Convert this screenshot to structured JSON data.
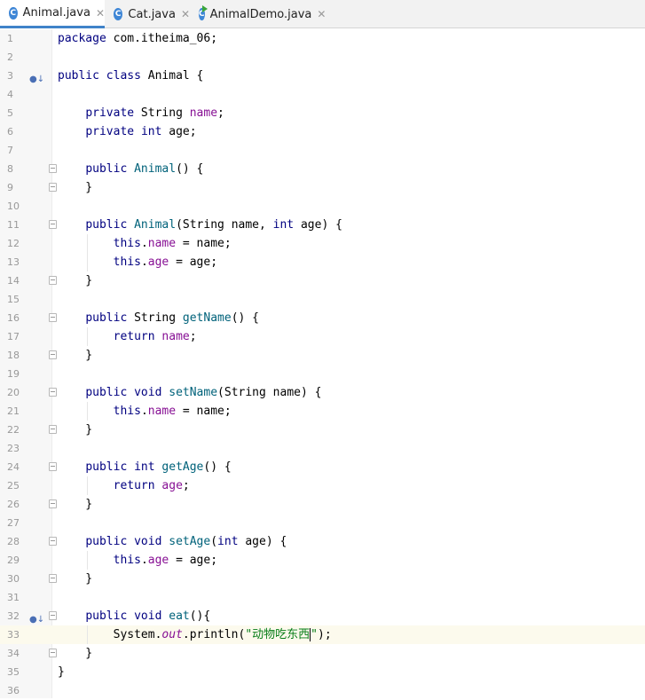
{
  "tabs": [
    {
      "label": "Animal.java",
      "active": true,
      "icon": "class-icon"
    },
    {
      "label": "Cat.java",
      "active": false,
      "icon": "class-icon"
    },
    {
      "label": "AnimalDemo.java",
      "active": false,
      "icon": "runnable-class-icon"
    }
  ],
  "editor": {
    "current_line": 33,
    "lines": [
      {
        "n": "1",
        "text": "package com.itheima_06;"
      },
      {
        "n": "2",
        "text": ""
      },
      {
        "n": "3",
        "text": "public class Animal {"
      },
      {
        "n": "4",
        "text": ""
      },
      {
        "n": "5",
        "text": "    private String name;"
      },
      {
        "n": "6",
        "text": "    private int age;"
      },
      {
        "n": "7",
        "text": ""
      },
      {
        "n": "8",
        "text": "    public Animal() {"
      },
      {
        "n": "9",
        "text": "    }"
      },
      {
        "n": "10",
        "text": ""
      },
      {
        "n": "11",
        "text": "    public Animal(String name, int age) {"
      },
      {
        "n": "12",
        "text": "        this.name = name;"
      },
      {
        "n": "13",
        "text": "        this.age = age;"
      },
      {
        "n": "14",
        "text": "    }"
      },
      {
        "n": "15",
        "text": ""
      },
      {
        "n": "16",
        "text": "    public String getName() {"
      },
      {
        "n": "17",
        "text": "        return name;"
      },
      {
        "n": "18",
        "text": "    }"
      },
      {
        "n": "19",
        "text": ""
      },
      {
        "n": "20",
        "text": "    public void setName(String name) {"
      },
      {
        "n": "21",
        "text": "        this.name = name;"
      },
      {
        "n": "22",
        "text": "    }"
      },
      {
        "n": "23",
        "text": ""
      },
      {
        "n": "24",
        "text": "    public int getAge() {"
      },
      {
        "n": "25",
        "text": "        return age;"
      },
      {
        "n": "26",
        "text": "    }"
      },
      {
        "n": "27",
        "text": ""
      },
      {
        "n": "28",
        "text": "    public void setAge(int age) {"
      },
      {
        "n": "29",
        "text": "        this.age = age;"
      },
      {
        "n": "30",
        "text": "    }"
      },
      {
        "n": "31",
        "text": ""
      },
      {
        "n": "32",
        "text": "    public void eat(){"
      },
      {
        "n": "33",
        "text": "        System.out.println(\"动物吃东西\");"
      },
      {
        "n": "34",
        "text": "    }"
      },
      {
        "n": "35",
        "text": "}"
      },
      {
        "n": "36",
        "text": ""
      }
    ]
  },
  "colors": {
    "keyword": "#000080",
    "field": "#871094",
    "method": "#00627a",
    "string": "#067d17",
    "current_line_bg": "#fcfaed",
    "tab_accent": "#4083c9"
  }
}
